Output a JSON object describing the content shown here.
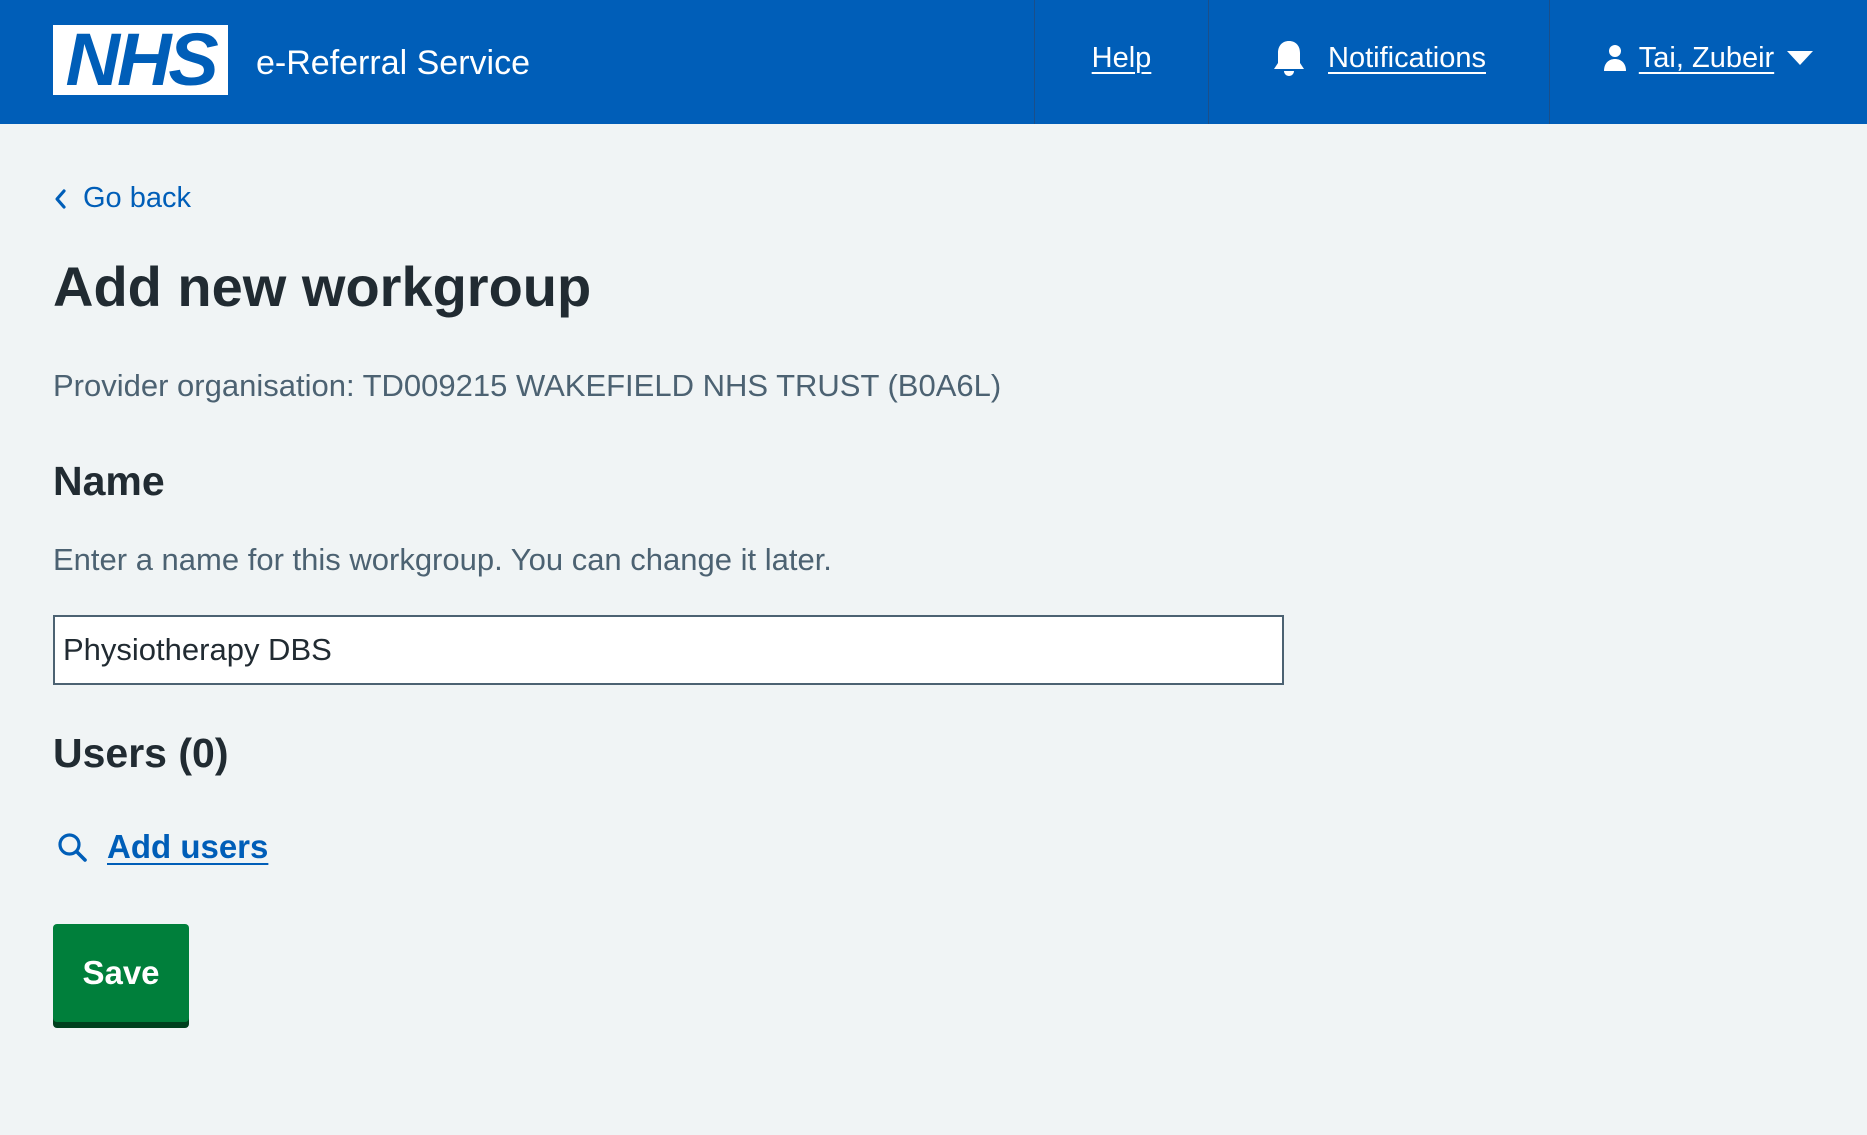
{
  "header": {
    "logo_text": "NHS",
    "service_name": "e-Referral Service",
    "nav": {
      "help_label": "Help",
      "notifications_label": "Notifications",
      "user_label": "Tai, Zubeir"
    },
    "colors": {
      "header_bg": "#005eb8",
      "logo_bg": "#ffffff"
    }
  },
  "main": {
    "back_label": "Go back",
    "title": "Add new workgroup",
    "provider_text": "Provider organisation: TD009215 WAKEFIELD NHS TRUST (B0A6L)",
    "name_field": {
      "label": "Name",
      "hint": "Enter a name for this workgroup. You can change it later.",
      "value": "Physiotherapy DBS"
    },
    "users": {
      "heading": "Users (0)",
      "add_users_label": "Add users"
    },
    "save_label": "Save",
    "colors": {
      "page_bg": "#f0f4f5",
      "link": "#005eb8",
      "primary_button": "#007f3b",
      "secondary_text": "#4c6272"
    }
  },
  "icons": [
    "chevron-left-icon",
    "bell-icon",
    "person-icon",
    "caret-down-icon",
    "search-icon"
  ]
}
